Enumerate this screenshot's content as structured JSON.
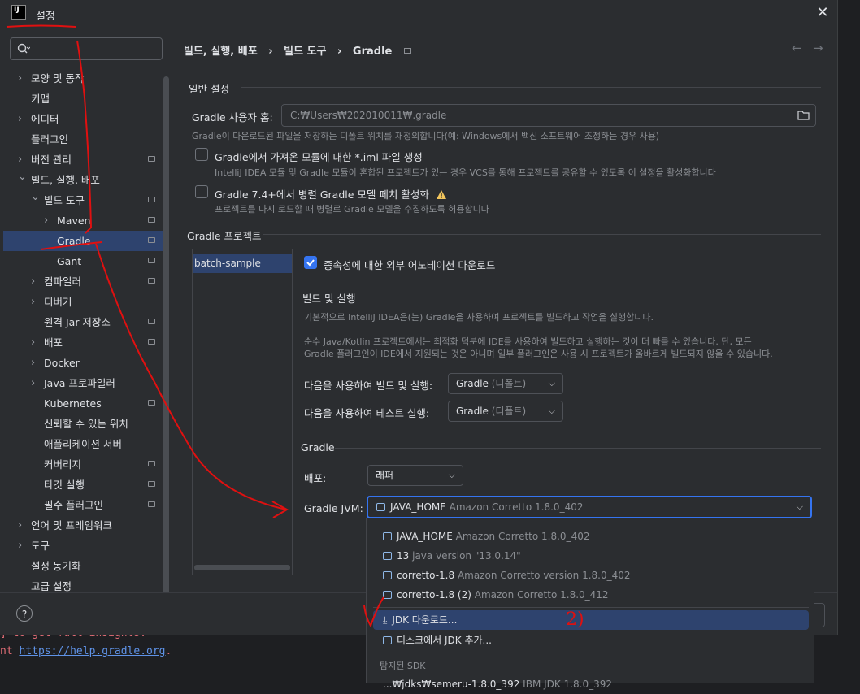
{
  "window": {
    "title": "설정"
  },
  "sidebar": {
    "search_placeholder": "",
    "items": [
      {
        "label": "모양 및 동작",
        "level": 0,
        "arrow": "right",
        "badge": false
      },
      {
        "label": "키맵",
        "level": 0,
        "arrow": "",
        "badge": false
      },
      {
        "label": "에디터",
        "level": 0,
        "arrow": "right",
        "badge": false
      },
      {
        "label": "플러그인",
        "level": 0,
        "arrow": "",
        "badge": false
      },
      {
        "label": "버전 관리",
        "level": 0,
        "arrow": "right",
        "badge": true
      },
      {
        "label": "빌드, 실행, 배포",
        "level": 0,
        "arrow": "down",
        "badge": false
      },
      {
        "label": "빌드 도구",
        "level": 1,
        "arrow": "down",
        "badge": true
      },
      {
        "label": "Maven",
        "level": 2,
        "arrow": "right",
        "badge": true
      },
      {
        "label": "Gradle",
        "level": 2,
        "arrow": "",
        "badge": true,
        "selected": true
      },
      {
        "label": "Gant",
        "level": 2,
        "arrow": "",
        "badge": true
      },
      {
        "label": "컴파일러",
        "level": 1,
        "arrow": "right",
        "badge": true
      },
      {
        "label": "디버거",
        "level": 1,
        "arrow": "right",
        "badge": false
      },
      {
        "label": "원격 Jar 저장소",
        "level": 1,
        "arrow": "",
        "badge": true
      },
      {
        "label": "배포",
        "level": 1,
        "arrow": "right",
        "badge": true
      },
      {
        "label": "Docker",
        "level": 1,
        "arrow": "right",
        "badge": false
      },
      {
        "label": "Java 프로파일러",
        "level": 1,
        "arrow": "right",
        "badge": false
      },
      {
        "label": "Kubernetes",
        "level": 1,
        "arrow": "",
        "badge": true
      },
      {
        "label": "신뢰할 수 있는 위치",
        "level": 1,
        "arrow": "",
        "badge": false
      },
      {
        "label": "애플리케이션 서버",
        "level": 1,
        "arrow": "",
        "badge": false
      },
      {
        "label": "커버리지",
        "level": 1,
        "arrow": "",
        "badge": true
      },
      {
        "label": "타깃 실행",
        "level": 1,
        "arrow": "",
        "badge": true
      },
      {
        "label": "필수 플러그인",
        "level": 1,
        "arrow": "",
        "badge": true
      },
      {
        "label": "언어 및 프레임워크",
        "level": 0,
        "arrow": "right",
        "badge": false
      },
      {
        "label": "도구",
        "level": 0,
        "arrow": "right",
        "badge": false
      },
      {
        "label": "설정 동기화",
        "level": 0,
        "arrow": "",
        "badge": false
      },
      {
        "label": "고급 설정",
        "level": 0,
        "arrow": "",
        "badge": false
      }
    ]
  },
  "breadcrumb": {
    "items": [
      "빌드, 실행, 배포",
      "빌드 도구",
      "Gradle"
    ],
    "separator": "›"
  },
  "general": {
    "title": "일반 설정",
    "home_label": "Gradle 사용자 홈:",
    "home_value": "C:₩Users₩202010011₩.gradle",
    "home_hint": "Gradle이 다운로드된 파일을 저장하는 디폴트 위치를 재정의합니다(예: Windows에서 백신 소프트웨어 조정하는 경우 사용)",
    "iml_label": "Gradle에서 가져온 모듈에 대한 *.iml 파일 생성",
    "iml_hint": "IntelliJ IDEA 모듈 및 Gradle 모듈이 혼합된 프로젝트가 있는 경우 VCS를 통해 프로젝트를 공유할 수 있도록 이 설정을 활성화합니다",
    "parallel_label": "Gradle 7.4+에서 병렬 Gradle 모델 페치 활성화",
    "parallel_hint": "프로젝트를 다시 로드할 때 병렬로 Gradle 모델을 수집하도록 허용합니다"
  },
  "project": {
    "title": "Gradle 프로젝트",
    "list": [
      "batch-sample"
    ],
    "annotations_label": "종속성에 대한 외부 어노테이션 다운로드",
    "build_title": "빌드 및 실행",
    "build_desc1": "기본적으로 IntelliJ IDEA은(는) Gradle을 사용하여 프로젝트를 빌드하고 작업을 실행합니다.",
    "build_desc2": "순수 Java/Kotlin 프로젝트에서는 최적화 덕분에 IDE를 사용하여 빌드하고 실행하는 것이 더 빠를 수 있습니다. 단, 모든",
    "build_desc3": "Gradle 플러그인이 IDE에서 지원되는 것은 아니며 일부 플러그인은 사용 시 프로젝트가 올바르게 빌드되지 않을 수 있습니다.",
    "build_run_label": "다음을 사용하여 빌드 및 실행:",
    "build_run_value": "Gradle",
    "build_run_suffix": "(디폴트)",
    "test_label": "다음을 사용하여 테스트 실행:",
    "test_value": "Gradle",
    "test_suffix": "(디폴트)",
    "gradle_title": "Gradle",
    "dist_label": "배포:",
    "dist_value": "래퍼",
    "jvm_label": "Gradle JVM:",
    "jvm_value": "JAVA_HOME",
    "jvm_detail": "Amazon Corretto 1.8.0_402"
  },
  "jvm_popup": {
    "items": [
      {
        "name": "JAVA_HOME",
        "detail": "Amazon Corretto 1.8.0_402"
      },
      {
        "name": "13",
        "detail": "java version \"13.0.14\""
      },
      {
        "name": "corretto-1.8",
        "detail": "Amazon Corretto version 1.8.0_402"
      },
      {
        "name": "corretto-1.8 (2)",
        "detail": "Amazon Corretto 1.8.0_412"
      }
    ],
    "download_label": "JDK 다운로드...",
    "add_label": "디스크에서 JDK 추가...",
    "detected_title": "탐지된 SDK",
    "detected_item": "...₩jdks₩semeru-1.8.0_392",
    "detected_detail": "IBM JDK 1.8.0_392"
  },
  "terminal": {
    "line1": "] to get full insights.",
    "line2_prefix": "nt ",
    "line2_link": "https://help.gradle.org",
    "line2_suffix": "."
  },
  "annotation": {
    "text": "2)"
  },
  "help": {
    "label": "?"
  },
  "colors": {
    "accent": "#3574f0",
    "selected_row": "#2e436e",
    "annotation": "#e01010",
    "link": "#5f93e8",
    "error_text": "#e06c75"
  }
}
